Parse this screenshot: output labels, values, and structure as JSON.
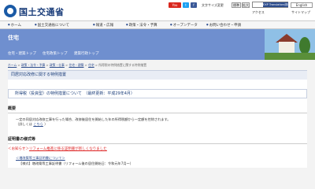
{
  "header": {
    "site_name": "国土交通省",
    "sns": {
      "youtube": "You",
      "twitter": "t",
      "facebook": "f"
    },
    "text_size_label": "文字サイズ変更",
    "text_size_std": "標準",
    "text_size_large": "拡大",
    "search_button": "EXP Translation/検索",
    "english": "English",
    "util_links": "サイトマップ",
    "access_label": "アクセス"
  },
  "gnav": [
    "ホーム",
    "国土交通省について",
    "報道・広報",
    "政策・法令・予算",
    "オープンデータ",
    "お問い合わせ・申請"
  ],
  "hero": {
    "title": "住宅",
    "links": [
      "住宅・建築トップ",
      "住宅政策トップ",
      "建築行政トップ"
    ]
  },
  "breadcrumb": [
    "ホーム",
    "政策・法令・予算",
    "政策・仕事",
    "住宅・建築",
    "住宅",
    "所得税の特例措置に関する特例措置"
  ],
  "page": {
    "heading": "同居対応改修に関する特例措置",
    "box_title": "所得税（投資型）の特例措置について　（最終更新：平成29年4月）",
    "overview_title": "概要",
    "overview_p1": "一定の同居対応改修工事を行った場合、改修後居住を開始した年の所得税額から一定額を控除されます。",
    "overview_p2_prefix": "（詳しくは",
    "overview_p2_link": "こちら",
    "overview_p2_suffix": "）",
    "forms_title": "証明書の様式等",
    "notice_prefix": "＜お知らせ＞",
    "notice_link": "リフォーム推進に係る証明書が新しくなりました",
    "sublink": "＜増改築等工事証明書について＞",
    "item": "【様式】増改築等工事証明書（リフォーム後の居住開始日：令和元年7月～）"
  }
}
